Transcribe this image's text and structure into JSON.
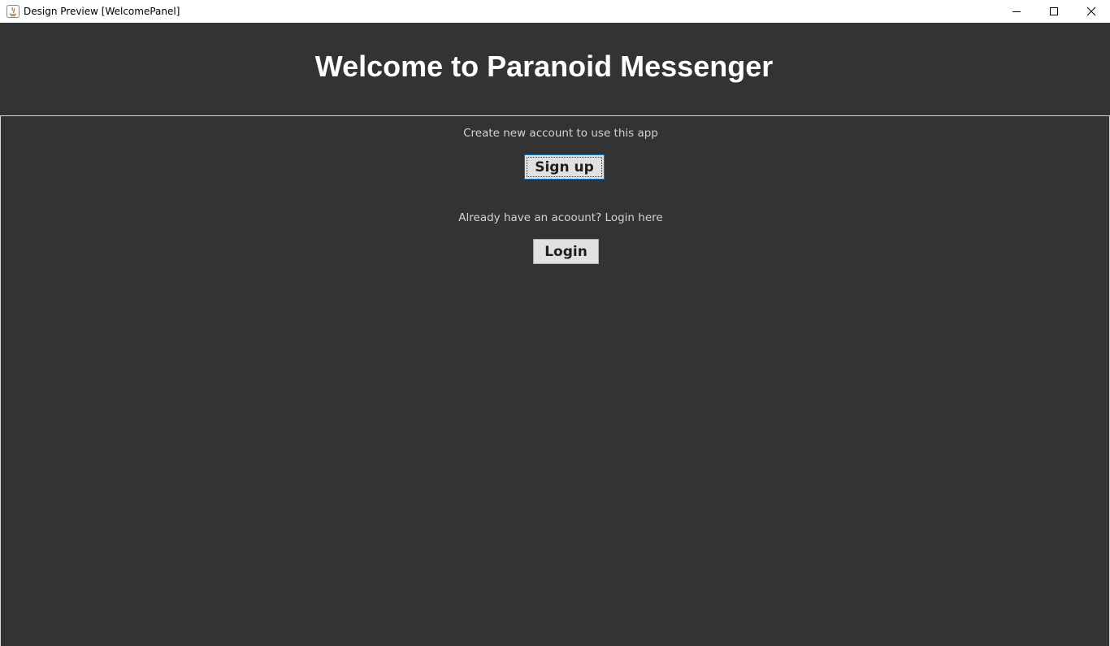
{
  "window": {
    "title": "Design Preview [WelcomePanel]",
    "app_icon": "java-icon",
    "controls": {
      "minimize_icon": "minimize-icon",
      "maximize_icon": "maximize-icon",
      "close_icon": "close-icon"
    }
  },
  "header": {
    "title": "Welcome to Paranoid Messenger"
  },
  "signup": {
    "prompt": "Create new account to use this app",
    "button_label": "Sign up"
  },
  "login": {
    "prompt": "Already have an acoount? Login here",
    "button_label": "Login"
  },
  "colors": {
    "background": "#333333",
    "header_text": "#ffffff",
    "prompt_text": "#d2d2d2",
    "button_face": "#e1e1e1",
    "focus_border": "#0078d7"
  }
}
